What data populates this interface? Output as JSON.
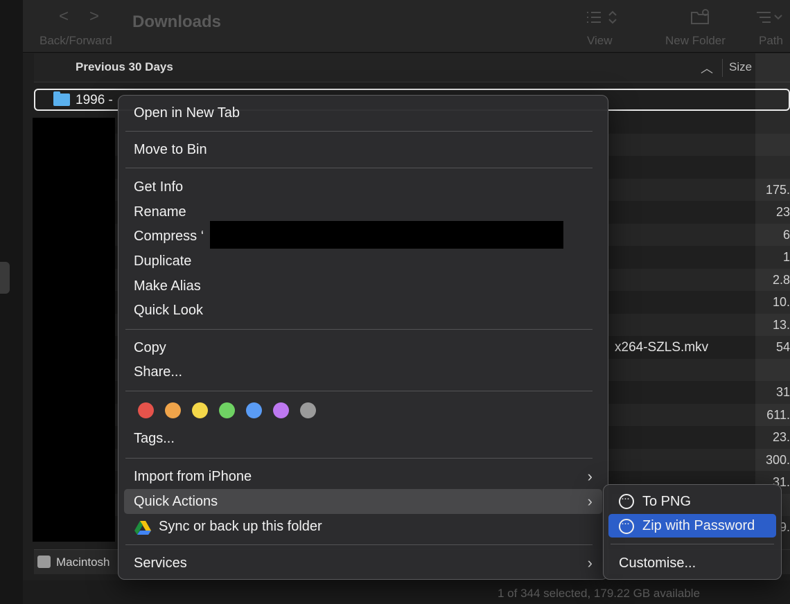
{
  "toolbar": {
    "title": "Downloads",
    "back_forward_label": "Back/Forward",
    "view_label": "View",
    "new_folder_label": "New Folder",
    "path_label": "Path",
    "back_glyph": "<",
    "forward_glyph": ">"
  },
  "list": {
    "group_title": "Previous 30 Days",
    "size_header": "Size",
    "selected_item_name": "1996 -",
    "rows": [
      {
        "name": "",
        "size": ""
      },
      {
        "name": "",
        "size": ""
      },
      {
        "name": "",
        "size": ""
      },
      {
        "name": "",
        "size": "175."
      },
      {
        "name": "",
        "size": "23"
      },
      {
        "name": "",
        "size": "6"
      },
      {
        "name": "",
        "size": "1"
      },
      {
        "name": "",
        "size": "2.8"
      },
      {
        "name": "",
        "size": "10."
      },
      {
        "name": "",
        "size": "13."
      },
      {
        "name": "x264-SZLS.mkv",
        "size": "54"
      },
      {
        "name": "",
        "size": ""
      },
      {
        "name": "",
        "size": "31"
      },
      {
        "name": "",
        "size": "611."
      },
      {
        "name": "",
        "size": "23."
      },
      {
        "name": "",
        "size": "300."
      },
      {
        "name": "",
        "size": "31."
      },
      {
        "name": "",
        "size": ""
      },
      {
        "name": "",
        "size": "9."
      }
    ]
  },
  "path_bar": {
    "disk_label": "Macintosh"
  },
  "status": {
    "text": "1 of 344 selected, 179.22 GB available"
  },
  "context_menu": {
    "open_new_tab": "Open in New Tab",
    "move_to_bin": "Move to Bin",
    "get_info": "Get Info",
    "rename": "Rename",
    "compress": "Compress ‘",
    "duplicate": "Duplicate",
    "make_alias": "Make Alias",
    "quick_look": "Quick Look",
    "copy": "Copy",
    "share": "Share...",
    "tags": "Tags...",
    "import_iphone": "Import from iPhone",
    "quick_actions": "Quick Actions",
    "sync_folder": "Sync or back up this folder",
    "services": "Services",
    "tag_colors": [
      "#e5534b",
      "#f0a44a",
      "#f4d749",
      "#6fd263",
      "#5a9cf5",
      "#bd78f0",
      "#9b9b9b"
    ]
  },
  "quick_actions_submenu": {
    "to_png": "To PNG",
    "zip_with_password": "Zip with Password",
    "customise": "Customise..."
  },
  "colors": {
    "selection_blue": "#2c5ec9",
    "folder_blue": "#5ab1ef"
  }
}
